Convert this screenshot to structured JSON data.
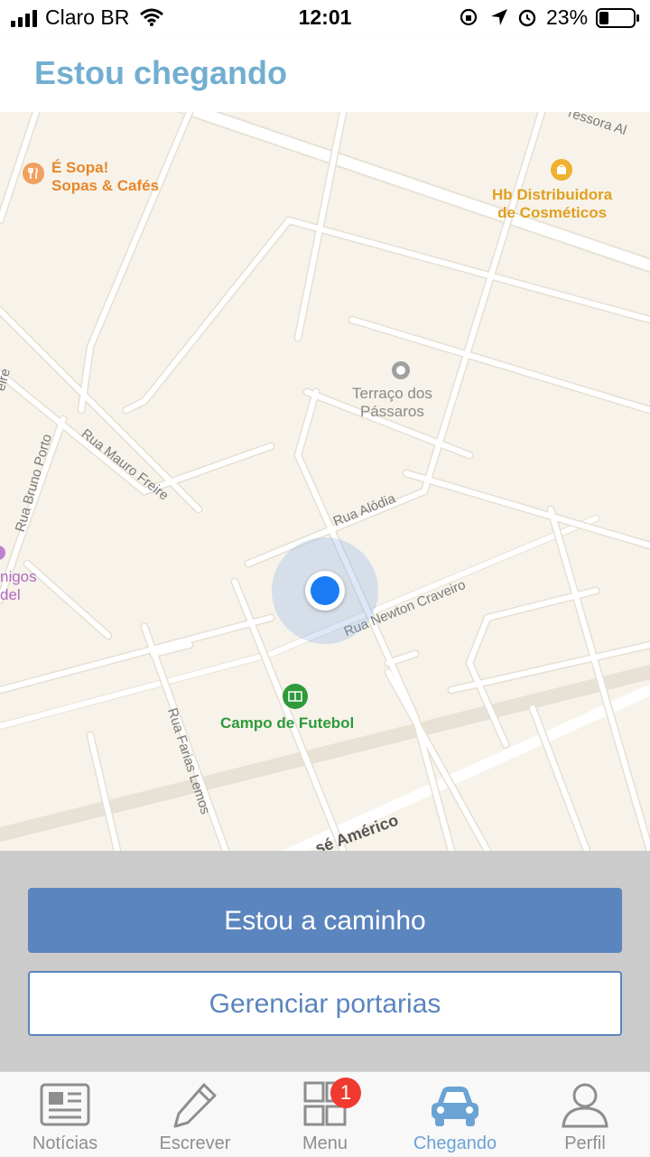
{
  "status_bar": {
    "carrier": "Claro BR",
    "time": "12:01",
    "battery_percent": "23%",
    "icons": [
      "signal-icon",
      "wifi-icon",
      "rotation-lock-icon",
      "location-arrow-icon",
      "alarm-icon",
      "battery-icon"
    ]
  },
  "header": {
    "title": "Estou chegando"
  },
  "map": {
    "pois": [
      {
        "name": "É Sopa!\nSopas & Cafés",
        "icon": "restaurant-icon",
        "color": "#e8862a"
      },
      {
        "name": "Hb Distribuidora\nde Cosméticos",
        "icon": "shopping-bag-icon",
        "color": "#e0a020"
      },
      {
        "name": "Terraço dos\nPássaros",
        "icon": "place-icon",
        "color": "#8a8a8a"
      },
      {
        "name": "Campo de Futebol",
        "icon": "soccer-field-icon",
        "color": "#2e9a3a"
      },
      {
        "name": "nigos\ndel",
        "icon": "place-icon",
        "color": "#b06ac0"
      }
    ],
    "roads": [
      "Rua Mauro Freire",
      "Rua Bruno Porto",
      "Rua Alódia",
      "Rua Newton Craveiro",
      "Rua Farias Lemos",
      "sé Américo",
      "ressora Al",
      "eire"
    ]
  },
  "actions": {
    "primary_label": "Estou a caminho",
    "secondary_label": "Gerenciar portarias"
  },
  "tabs": [
    {
      "label": "Notícias",
      "icon": "newspaper-icon"
    },
    {
      "label": "Escrever",
      "icon": "pencil-icon"
    },
    {
      "label": "Menu",
      "icon": "grid-icon",
      "badge": "1"
    },
    {
      "label": "Chegando",
      "icon": "car-icon",
      "active": true
    },
    {
      "label": "Perfil",
      "icon": "user-icon"
    }
  ],
  "colors": {
    "accent": "#72aed0",
    "button": "#5b85be",
    "active_tab": "#6aa3d4",
    "badge": "#f03a2f",
    "location": "#1a7cf5"
  }
}
